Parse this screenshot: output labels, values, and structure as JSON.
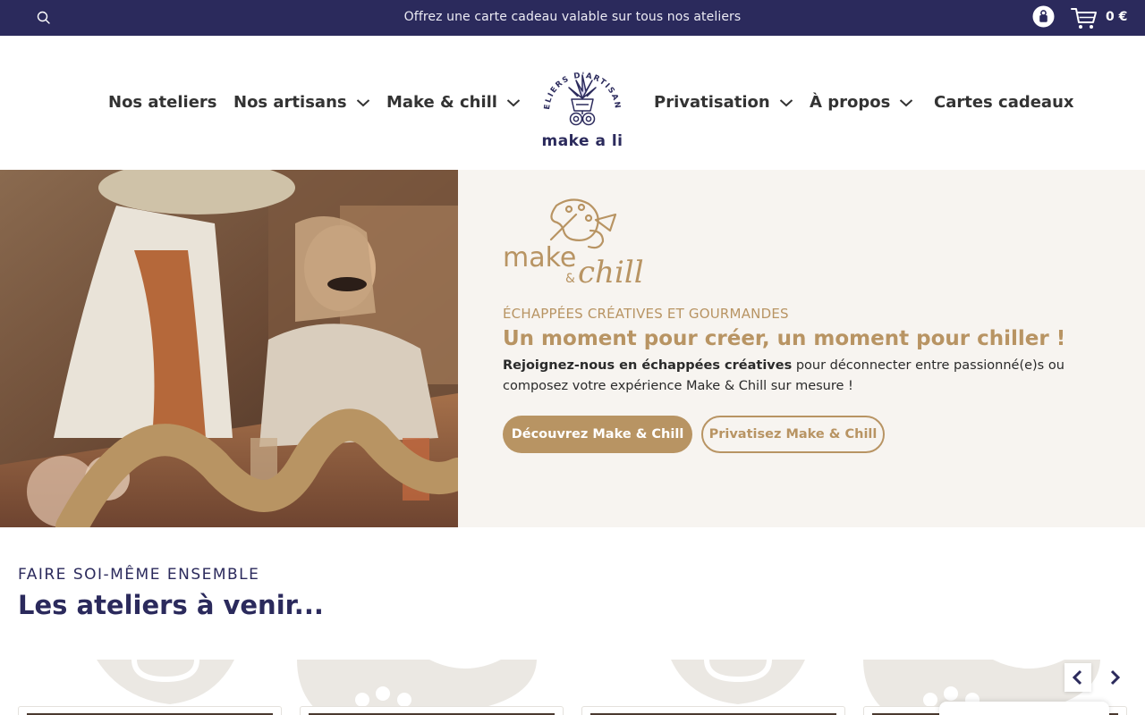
{
  "colors": {
    "navy": "#2b2a5c",
    "gold": "#b89463",
    "cream": "#f7f4f0"
  },
  "topbar": {
    "promo_text": "Offrez une carte cadeau valable sur tous nos ateliers",
    "cart_total": "0 €",
    "icons": [
      "search-icon",
      "account-icon",
      "cart-icon"
    ]
  },
  "nav": {
    "items": [
      {
        "label": "Nos ateliers",
        "has_dropdown": false
      },
      {
        "label": "Nos artisans",
        "has_dropdown": true
      },
      {
        "label": "Make & chill",
        "has_dropdown": true
      },
      {
        "label": "Privatisation",
        "has_dropdown": true
      },
      {
        "label": "À propos",
        "has_dropdown": true
      },
      {
        "label": "Cartes cadeaux",
        "has_dropdown": false
      }
    ],
    "logo": {
      "ring_text": "ATELIERS D'ARTISANAT",
      "brand": "make a li"
    }
  },
  "hero": {
    "logo_text": {
      "line1": "make",
      "amp": "&",
      "line2": "chill"
    },
    "eyebrow": "ÉCHAPPÉES CRÉATIVES ET GOURMANDES",
    "title": "Un moment pour créer, un moment pour chiller !",
    "body_bold": "Rejoignez-nous en échappées créatives",
    "body_rest": " pour déconnecter entre passionné(e)s ou composez votre expérience Make & Chill sur mesure !",
    "cta_primary": "Découvrez Make & Chill",
    "cta_secondary": "Privatisez Make & Chill"
  },
  "upcoming": {
    "eyebrow": "FAIRE SOI-MÊME ENSEMBLE",
    "title": "Les ateliers à venir..."
  }
}
